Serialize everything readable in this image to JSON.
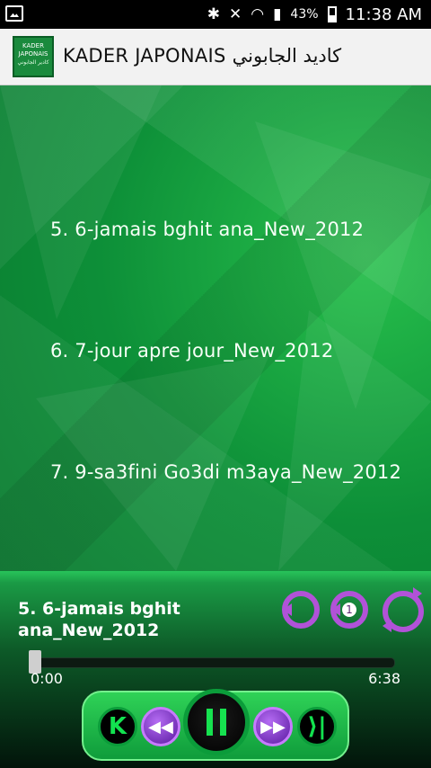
{
  "status_bar": {
    "battery_percent": "43%",
    "time": "11:38 AM",
    "icons": [
      "gallery-icon",
      "bluetooth-icon",
      "mute-icon",
      "wifi-icon",
      "signal-icon",
      "battery-icon"
    ]
  },
  "app": {
    "title": "KADER JAPONAIS كاديد الجابوني",
    "logo": {
      "line1": "KADER",
      "line2": "JAPONAIS",
      "line3": "كادير الجابوني"
    }
  },
  "tracks": [
    {
      "label": "5. 6-jamais bghit ana_New_2012"
    },
    {
      "label": "6. 7-jour apre jour_New_2012"
    },
    {
      "label": "7. 9-sa3fini Go3di m3aya_New_2012"
    }
  ],
  "player": {
    "now_playing": "5. 6-jamais bghit ana_New_2012",
    "current_time": "0:00",
    "duration": "6:38",
    "progress": 0,
    "accent_color": "#b152d8",
    "repeat_one_badge": "1"
  }
}
